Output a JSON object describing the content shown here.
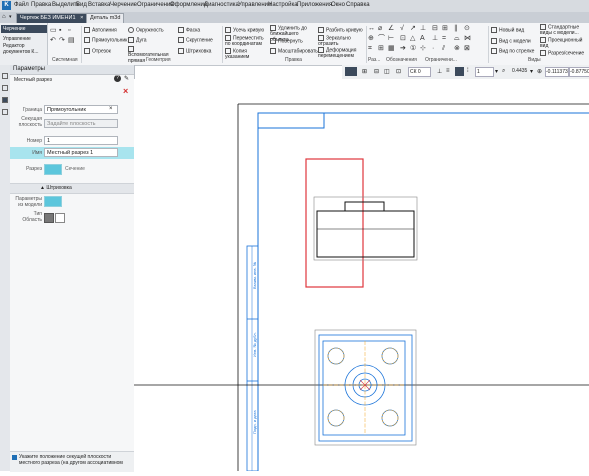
{
  "app": {
    "logo_text": "K"
  },
  "menu": [
    "Файл",
    "Правка",
    "Выделить",
    "Вид",
    "Вставка",
    "Черчение",
    "Ограничения",
    "Оформление",
    "Диагностика",
    "Управление",
    "Настройка",
    "Приложения",
    "Окно",
    "Справка"
  ],
  "doc_tabs": [
    {
      "label": "Чертеж БЕЗ ИМЕНИ1",
      "active": true
    },
    {
      "label": "Деталь m3d",
      "active": false
    }
  ],
  "ribbon": {
    "modes": [
      "Черчение",
      "Управление",
      "Редактор документов К..."
    ],
    "sistemnaya": "Системная",
    "geometry_cmds": [
      "Автолиния",
      "Прямоугольник",
      "Отрезок",
      "Окружность",
      "Дуга",
      "Вспомогательная прямая",
      "Фаска",
      "Скругление",
      "Штриховка"
    ],
    "edit_cmds": [
      "Усечь кривую",
      "Переместить по координатам",
      "Копия указанием",
      "Удлинить до ближайшего объекта",
      "Повернуть",
      "Масштабировать",
      "Разбить кривую",
      "Зеркально отразить",
      "Деформация перемещением"
    ],
    "right_cmds": [
      "Новый вид",
      "Вид с модели",
      "Вид по стрелке",
      "Стандартные виды с модели...",
      "Проекционный вид",
      "Разрез/сечение"
    ],
    "groups": {
      "geometry": "Геометрия",
      "edit": "Правка",
      "size": "Раз...",
      "designation": "Обозначения",
      "constraints": "Ограничени...",
      "views": "Виды"
    }
  },
  "drawtool": {
    "style": "СК 0",
    "scale": "1",
    "zoom": "0.4435",
    "coords": "-0.111373",
    "coord2": "-0.87750"
  },
  "panel": {
    "title": "Параметры",
    "subtitle": "Местный разрез",
    "boundary_label": "Граница",
    "boundary_value": "Прямоугольник",
    "plane_label": "Секущая плоскость",
    "plane_value": "Задайте плоскость",
    "number_label": "Номер",
    "number_value": "1",
    "name_label": "Имя",
    "name_value": "Местный разрез 1",
    "cut_label": "Разрез",
    "section_label": "Сечение",
    "hatch_header": "Штриховка",
    "model_param_label": "Параметры из модели",
    "type_label": "Тип",
    "color_label": "Область",
    "hint": "Укажите положение секущей плоскости местного разреза (на другом ассоциативном"
  },
  "drawing": {
    "stamp_texts": [
      "Взаим. инв. №",
      "Инв. № дубл.",
      "Подп. и дата"
    ],
    "section_frame_color": "#e0363c",
    "line_color": "#1a73d9"
  }
}
